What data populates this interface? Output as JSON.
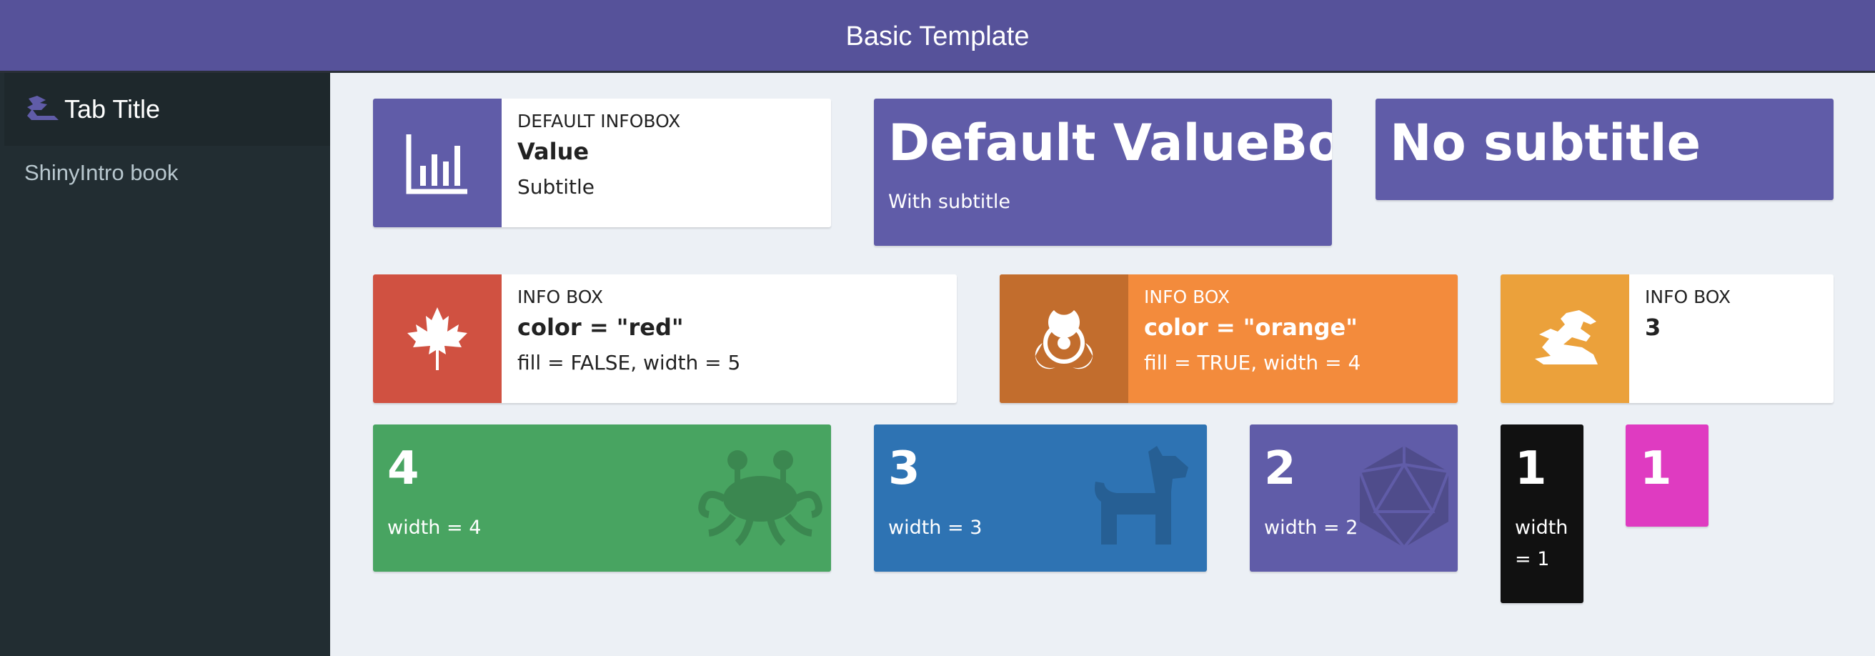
{
  "header": {
    "title": "Basic Template"
  },
  "sidebar": {
    "tab_title": "Tab Title",
    "link": "ShinyIntro book"
  },
  "colors": {
    "header": "#56529a",
    "sidebar": "#222d32",
    "purple": "#605ca8",
    "red": "#d05141",
    "red_dark": "#d05141",
    "orange": "#f38b3c",
    "orange_dark": "#c26d2d",
    "yellow": "#eba13b",
    "green": "#48a461",
    "blue": "#2e73b3",
    "black": "#111111",
    "fuchsia": "#df3bc1"
  },
  "infobox_default": {
    "label": "DEFAULT INFOBOX",
    "value": "Value",
    "subtitle": "Subtitle",
    "icon": "bar-chart-icon"
  },
  "valuebox_default": {
    "value": "Default ValueBox",
    "subtitle": "With subtitle"
  },
  "valuebox_nosub": {
    "value": "No subtitle"
  },
  "infobox_red": {
    "label": "INFO BOX",
    "value": "color = \"red\"",
    "subtitle": "fill = FALSE, width = 5",
    "icon": "maple-leaf-icon"
  },
  "infobox_orange": {
    "label": "INFO BOX",
    "value": "color = \"orange\"",
    "subtitle": "fill = TRUE, width = 4",
    "icon": "biohazard-icon"
  },
  "infobox_3": {
    "label": "INFO BOX",
    "value": "3",
    "icon": "dragon-icon"
  },
  "vb_4": {
    "value": "4",
    "subtitle": "width = 4",
    "icon": "spaghetti-monster-icon"
  },
  "vb_3": {
    "value": "3",
    "subtitle": "width = 3",
    "icon": "dog-icon"
  },
  "vb_2": {
    "value": "2",
    "subtitle": "width = 2",
    "icon": "d20-icon"
  },
  "vb_1a": {
    "value": "1",
    "subtitle_line1": "width",
    "subtitle_line2": "= 1"
  },
  "vb_1b": {
    "value": "1"
  }
}
